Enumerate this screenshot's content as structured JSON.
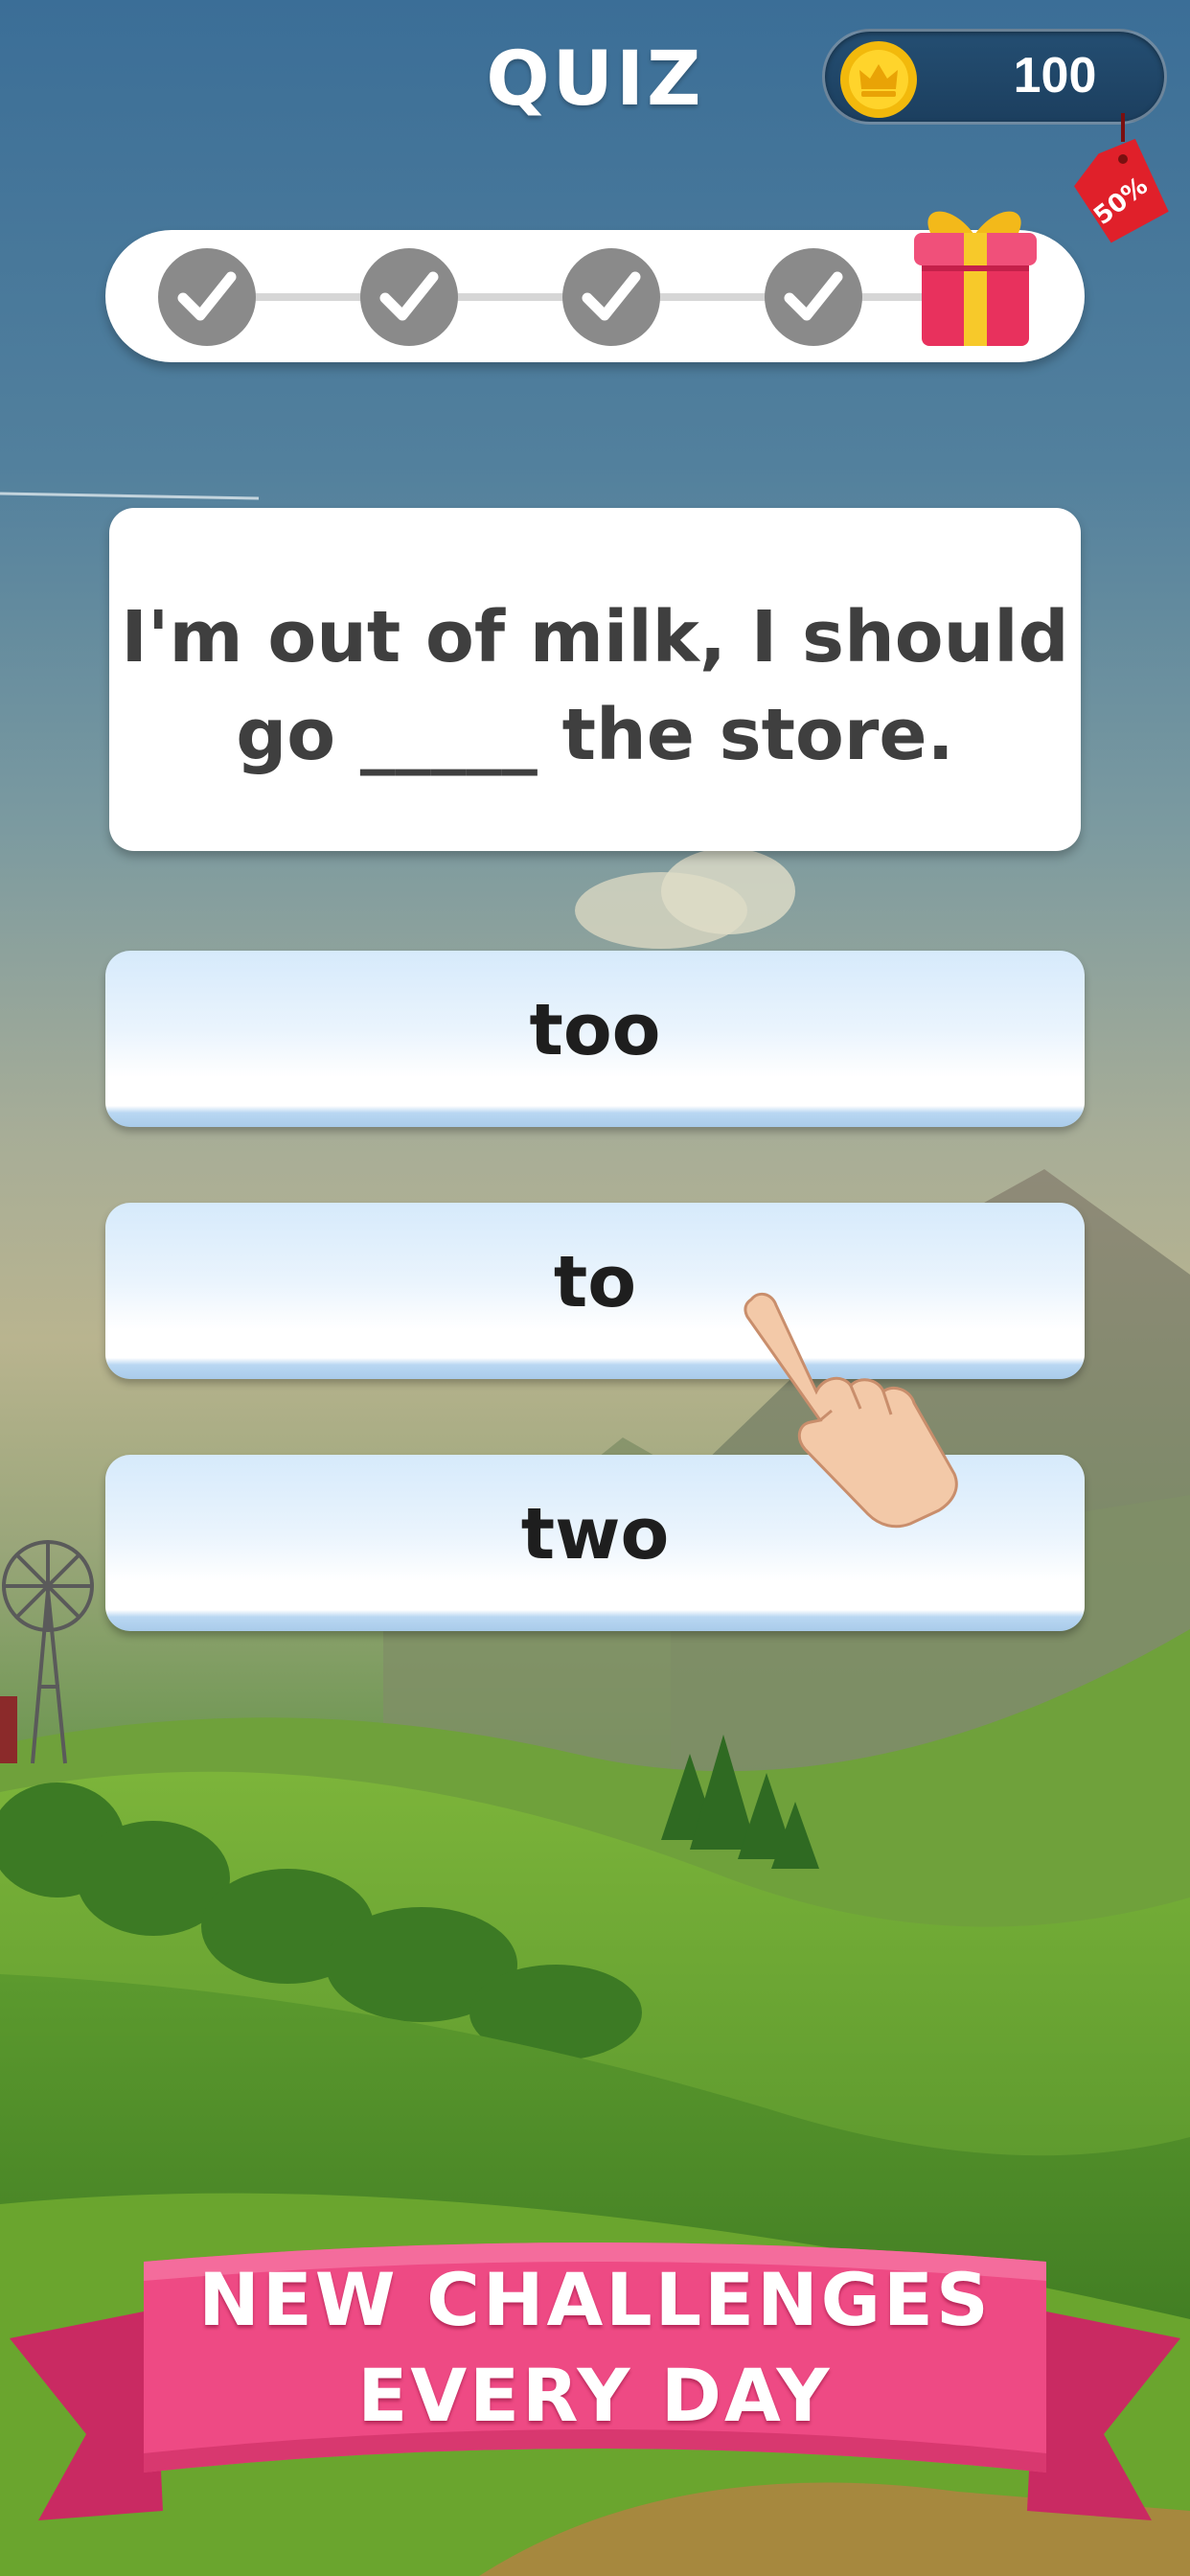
{
  "header": {
    "title": "QUIZ",
    "coins": "100",
    "coin_icon": "crown-coin-icon",
    "sale_tag": "50%"
  },
  "progress": {
    "completed_steps": 4,
    "total_steps": 4,
    "step_icon": "checkmark-icon",
    "reward_icon": "gift-icon"
  },
  "question": {
    "line1": "I'm out of milk, I should",
    "line2": "go  _____  the store."
  },
  "answers": [
    {
      "label": "too"
    },
    {
      "label": "to"
    },
    {
      "label": "two"
    }
  ],
  "banner": {
    "line1": "NEW CHALLENGES",
    "line2": "EVERY DAY"
  },
  "colors": {
    "banner_pink": "#e8417a",
    "step_grey": "#8a8a8a",
    "coin_box": "#1f4566",
    "answer_fill": "#e4f1fc"
  }
}
